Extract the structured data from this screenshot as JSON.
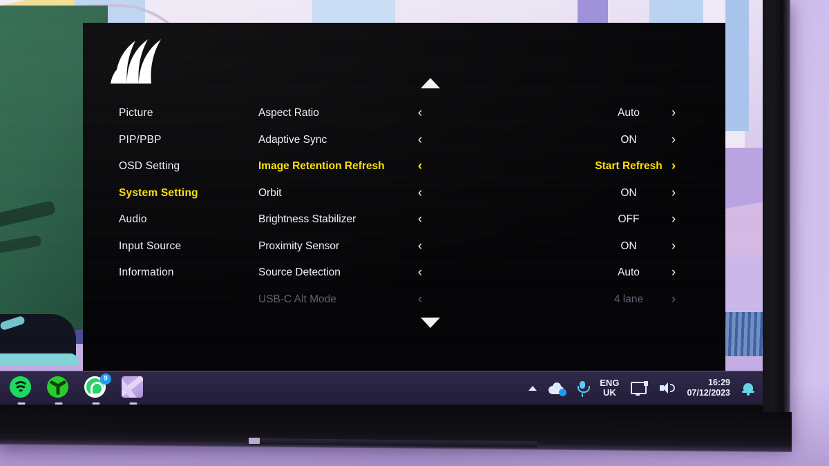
{
  "osd": {
    "brand_logo": "corsair-sails-logo",
    "scroll_up_icon": "triangle-up-icon",
    "scroll_down_icon": "triangle-down-icon",
    "nav": [
      {
        "label": "Picture",
        "selected": false
      },
      {
        "label": "PIP/PBP",
        "selected": false
      },
      {
        "label": "OSD Setting",
        "selected": false
      },
      {
        "label": "System Setting",
        "selected": true
      },
      {
        "label": "Audio",
        "selected": false
      },
      {
        "label": "Input Source",
        "selected": false
      },
      {
        "label": "Information",
        "selected": false
      }
    ],
    "left_chevron": "‹",
    "right_chevron": "›",
    "rows": [
      {
        "label": "Aspect Ratio",
        "value": "Auto",
        "selected": false,
        "disabled": false
      },
      {
        "label": "Adaptive Sync",
        "value": "ON",
        "selected": false,
        "disabled": false
      },
      {
        "label": "Image Retention Refresh",
        "value": "Start Refresh",
        "selected": true,
        "disabled": false
      },
      {
        "label": "Orbit",
        "value": "ON",
        "selected": false,
        "disabled": false
      },
      {
        "label": "Brightness Stabilizer",
        "value": "OFF",
        "selected": false,
        "disabled": false
      },
      {
        "label": "Proximity Sensor",
        "value": "ON",
        "selected": false,
        "disabled": false
      },
      {
        "label": "Source Detection",
        "value": "Auto",
        "selected": false,
        "disabled": false
      },
      {
        "label": "USB-C Alt Mode",
        "value": "4 lane",
        "selected": false,
        "disabled": true
      }
    ],
    "colors": {
      "highlight": "#ffe000",
      "text": "#eef2f7",
      "disabled": "#5d6270",
      "background": "#040406"
    }
  },
  "taskbar": {
    "apps": [
      {
        "name": "Spotify",
        "icon": "spotify-icon",
        "badge": ""
      },
      {
        "name": "Fan Control",
        "icon": "fan-icon",
        "badge": ""
      },
      {
        "name": "WhatsApp",
        "icon": "whatsapp-icon",
        "badge": "9"
      },
      {
        "name": "Affinity Photo",
        "icon": "affinity-icon",
        "badge": ""
      }
    ],
    "tray": {
      "overflow_icon": "chevron-up-icon",
      "cloud_icon": "onedrive-cloud-icon",
      "microphone_icon": "microphone-icon",
      "language_primary": "ENG",
      "language_secondary": "UK",
      "display_icon": "display-icon",
      "volume_icon": "volume-icon",
      "time": "16:29",
      "date": "07/12/2023",
      "notification_icon": "bell-icon"
    }
  }
}
